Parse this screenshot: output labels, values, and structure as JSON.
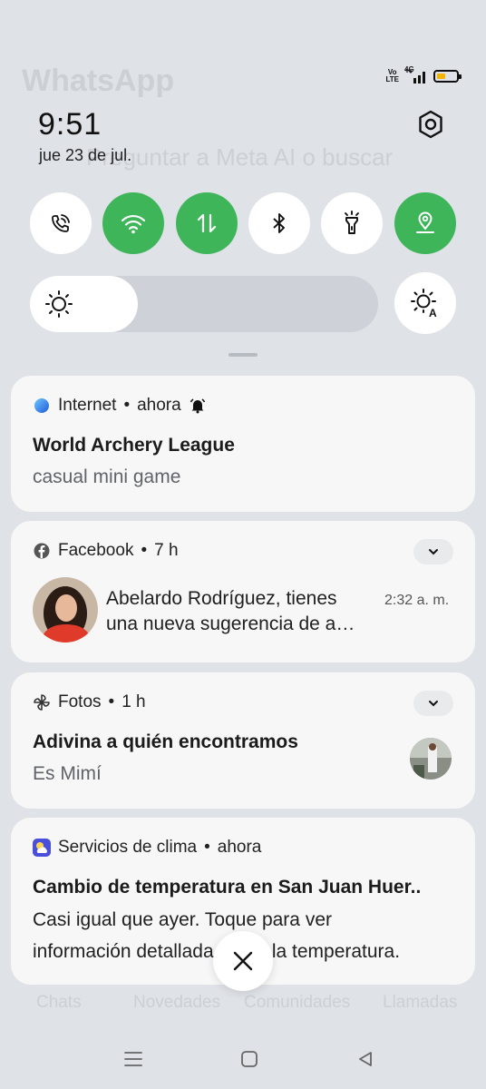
{
  "status_bar": {
    "volte_line1": "Vo",
    "volte_line2": "LTE",
    "network": "4G",
    "battery_percent": 55
  },
  "header": {
    "time": "9:51",
    "date": "jue 23 de jul."
  },
  "quick_settings": {
    "tiles": [
      {
        "name": "wifi-calling",
        "icon": "wifi-calling-icon",
        "active": false
      },
      {
        "name": "wifi",
        "icon": "wifi-icon",
        "active": true
      },
      {
        "name": "mobile-data",
        "icon": "mobile-data-icon",
        "active": true
      },
      {
        "name": "bluetooth",
        "icon": "bluetooth-icon",
        "active": false
      },
      {
        "name": "flashlight",
        "icon": "flashlight-icon",
        "active": false
      },
      {
        "name": "location",
        "icon": "location-icon",
        "active": true
      }
    ],
    "brightness_level": 0.31
  },
  "notifications": [
    {
      "app": "Internet",
      "time": "ahora",
      "title": "World Archery League",
      "body": "casual mini game"
    },
    {
      "app": "Facebook",
      "time": "7 h",
      "message_line1": "Abelardo Rodríguez, tienes",
      "message_line2": "una nueva sugerencia de a…",
      "message_time": "2:32 a. m."
    },
    {
      "app": "Fotos",
      "time": "1 h",
      "title": "Adivina a quién encontramos",
      "body": "Es Mimí"
    },
    {
      "app": "Servicios de clima",
      "time": "ahora",
      "title": "Cambio de temperatura en San Juan Huer..",
      "body_line1": "Casi igual que ayer. Toque para ver",
      "body_line2": "información detallada sobre la temperatura."
    }
  ],
  "background_app": {
    "title": "WhatsApp",
    "search_placeholder": "Preguntar a Meta AI o buscar",
    "tabs": [
      "Chats",
      "Novedades",
      "Comunidades",
      "Llamadas"
    ]
  },
  "colors": {
    "accent_green": "#3fb55a",
    "battery_yellow": "#f5b400",
    "panel_bg": "#dfe2e7",
    "card_bg": "#f7f7f8"
  }
}
